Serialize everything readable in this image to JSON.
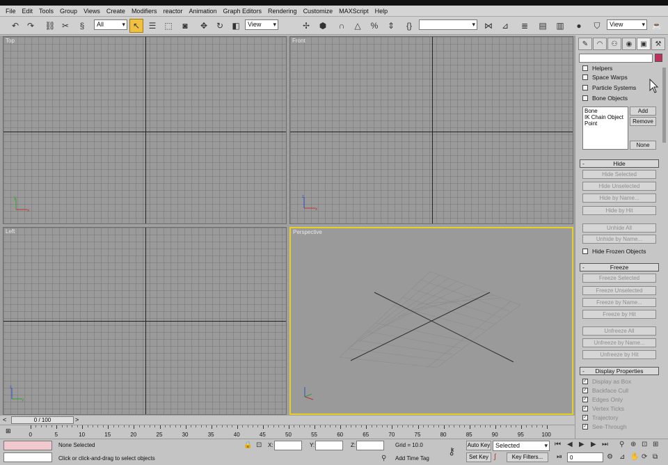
{
  "menu": [
    "File",
    "Edit",
    "Tools",
    "Group",
    "Views",
    "Create",
    "Modifiers",
    "reactor",
    "Animation",
    "Graph Editors",
    "Rendering",
    "Customize",
    "MAXScript",
    "Help"
  ],
  "toolbar": {
    "selection_filter": "All",
    "ref_coord": "View",
    "named_selection": "",
    "render_view": "View"
  },
  "viewports": {
    "top": "Top",
    "front": "Front",
    "left": "Left",
    "perspective": "Perspective"
  },
  "panel": {
    "categories": [
      "Helpers",
      "Space Warps",
      "Particle Systems",
      "Bone Objects"
    ],
    "list_items": [
      "Bone",
      "IK Chain Object",
      "Point"
    ],
    "add": "Add",
    "remove": "Remove",
    "none": "None",
    "hide_rollout": "Hide",
    "hide_buttons": [
      "Hide Selected",
      "Hide Unselected",
      "Hide by Name...",
      "Hide by Hit"
    ],
    "unhide_buttons": [
      "Unhide All",
      "Unhide by Name..."
    ],
    "hide_frozen": "Hide Frozen Objects",
    "freeze_rollout": "Freeze",
    "freeze_buttons": [
      "Freeze Selected",
      "Freeze Unselected",
      "Freeze by Name...",
      "Freeze by Hit"
    ],
    "unfreeze_buttons": [
      "Unfreeze All",
      "Unfreeze by Name...",
      "Unfreeze by Hit"
    ],
    "display_rollout": "Display Properties",
    "display_options": [
      "Display as Box",
      "Backface Cull",
      "Edges Only",
      "Vertex Ticks",
      "Trajectory",
      "See-Through"
    ],
    "collapse_symbol": "-"
  },
  "timeline": {
    "slider": "0 / 100",
    "ticks": [
      "0",
      "5",
      "10",
      "15",
      "20",
      "25",
      "30",
      "35",
      "40",
      "45",
      "50",
      "55",
      "60",
      "65",
      "70",
      "75",
      "80",
      "85",
      "90",
      "95",
      "100"
    ]
  },
  "status": {
    "selection": "None Selected",
    "prompt": "Click or click-and-drag to select objects",
    "x_label": "X:",
    "y_label": "Y:",
    "z_label": "Z:",
    "grid": "Grid = 10.0",
    "add_time_tag": "Add Time Tag",
    "auto_key": "Auto Key",
    "set_key": "Set Key",
    "key_mode": "Selected",
    "key_filters": "Key Filters...",
    "frame": "0"
  }
}
